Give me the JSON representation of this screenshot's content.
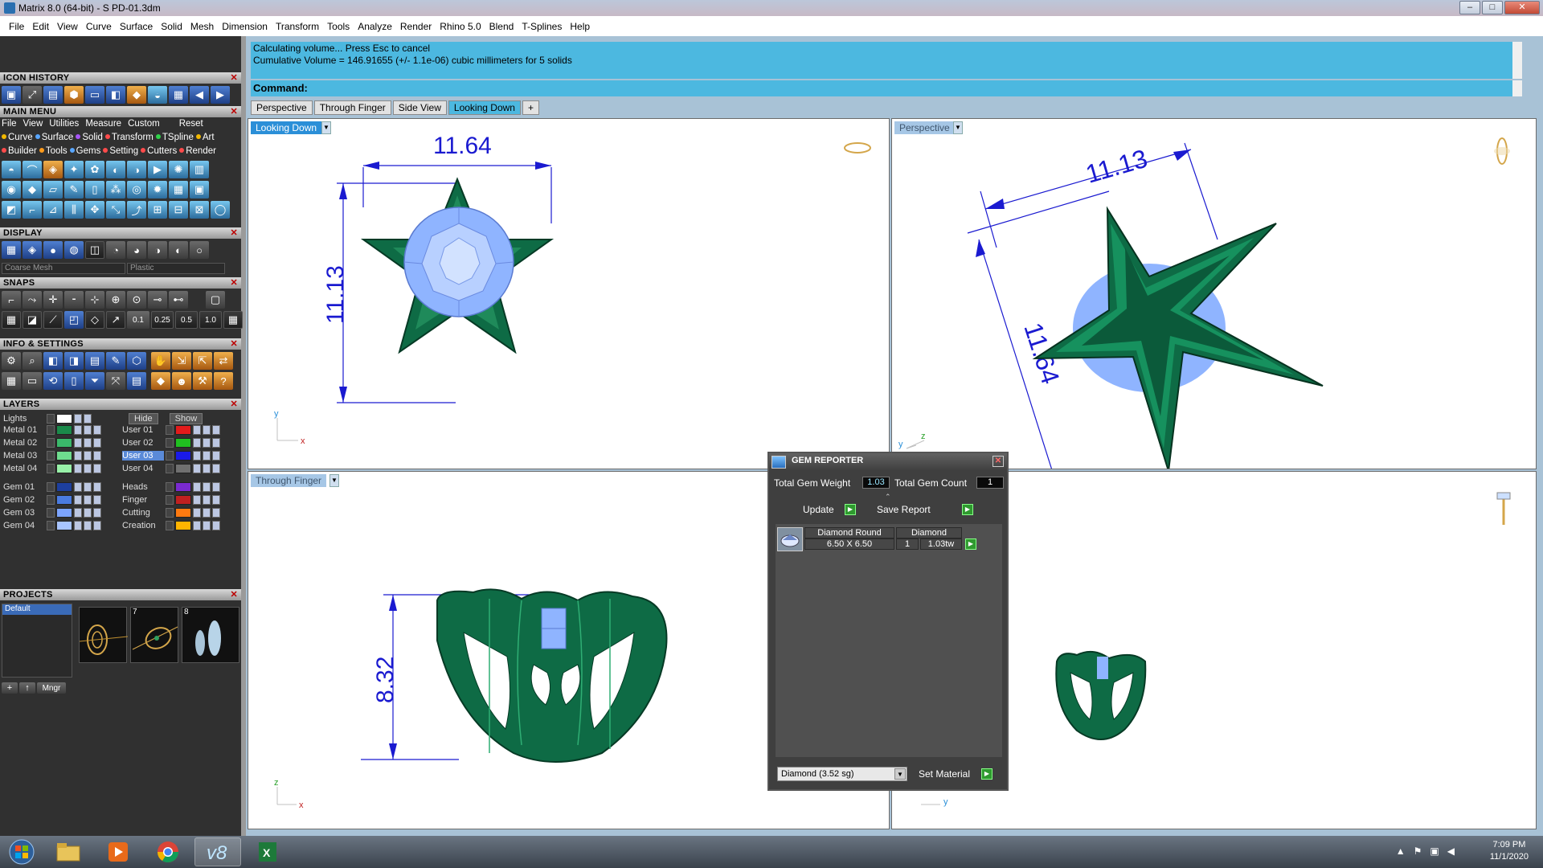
{
  "window": {
    "title": "Matrix 8.0 (64-bit) - S PD-01.3dm",
    "buttons": [
      "–",
      "□",
      "✕"
    ]
  },
  "menubar": [
    "File",
    "Edit",
    "View",
    "Curve",
    "Surface",
    "Solid",
    "Mesh",
    "Dimension",
    "Transform",
    "Tools",
    "Analyze",
    "Render",
    "Rhino 5.0",
    "Blend",
    "T-Splines",
    "Help"
  ],
  "left_panel": {
    "icon_history": "ICON HISTORY",
    "main_menu": "MAIN MENU",
    "main_menu_items": [
      "File",
      "View",
      "Utilities",
      "Measure",
      "Custom",
      "Reset"
    ],
    "menu_row2": [
      "Curve",
      "Surface",
      "Solid",
      "Transform",
      "TSpline",
      "Art"
    ],
    "menu_row3": [
      "Builder",
      "Tools",
      "Gems",
      "Setting",
      "Cutters",
      "Render"
    ],
    "dot_colors": [
      "#f2b800",
      "#58a6ff",
      "#a855f7",
      "#2fd34a",
      "#ff4b4b",
      "#ff9b1c"
    ],
    "display": "DISPLAY",
    "display_mesh": "Coarse Mesh",
    "display_material": "Plastic",
    "snaps": "SNAPS",
    "snap_values": [
      "0.1",
      "0.25",
      "0.5",
      "1.0"
    ],
    "info_settings": "INFO & SETTINGS",
    "layers": "LAYERS",
    "layers_lights": "Lights",
    "hide_label": "Hide",
    "show_label": "Show",
    "layer_left": [
      {
        "name": "Metal 01",
        "color": "#1a8a4a"
      },
      {
        "name": "Metal 02",
        "color": "#3ab86a"
      },
      {
        "name": "Metal 03",
        "color": "#6edc8e"
      },
      {
        "name": "Metal 04",
        "color": "#98f0a8"
      },
      {
        "name": "Gem 01",
        "color": "#1d3f9e"
      },
      {
        "name": "Gem 02",
        "color": "#4a7be0"
      },
      {
        "name": "Gem 03",
        "color": "#7ca4ff"
      },
      {
        "name": "Gem 04",
        "color": "#a8c4ff"
      }
    ],
    "layer_right": [
      {
        "name": "User 01",
        "color": "#e21b1b"
      },
      {
        "name": "User 02",
        "color": "#20c020"
      },
      {
        "name": "User 03",
        "color": "#1a1ae8"
      },
      {
        "name": "User 04",
        "color": "#707070"
      },
      {
        "name": "Heads",
        "color": "#7a2ad0"
      },
      {
        "name": "Finger",
        "color": "#c02020"
      },
      {
        "name": "Cutting",
        "color": "#ff7a10"
      },
      {
        "name": "Creation",
        "color": "#ffb400"
      }
    ],
    "projects": "PROJECTS",
    "project_default": "Default",
    "project_numbers": [
      "7",
      "8"
    ],
    "mngr": "Mngr"
  },
  "command": {
    "line1": "Calculating volume... Press Esc to cancel",
    "line2": "Cumulative Volume = 146.91655 (+/- 1.1e-06) cubic millimeters for 5 solids",
    "prompt": "Command:"
  },
  "tabs": [
    "Perspective",
    "Through Finger",
    "Side View",
    "Looking Down",
    "+"
  ],
  "viewports": {
    "top_left": {
      "label": "Looking Down",
      "dims": {
        "w": "11.64",
        "h": "11.13"
      },
      "axes": [
        "y",
        "x"
      ]
    },
    "top_right": {
      "label": "Perspective",
      "dims": {
        "a": "11.13",
        "b": "11.64"
      },
      "axes": [
        "y",
        "z"
      ]
    },
    "bottom_left": {
      "label": "Through Finger",
      "dims": {
        "h": "8.32"
      },
      "axes": [
        "z",
        "x"
      ]
    },
    "bottom_right": {
      "axes": [
        "y"
      ]
    }
  },
  "gem_reporter": {
    "title": "GEM REPORTER",
    "total_weight_label": "Total Gem Weight",
    "total_weight": "1.03",
    "total_count_label": "Total Gem Count",
    "total_count": "1",
    "update": "Update",
    "save_report": "Save Report",
    "row_shape": "Diamond Round",
    "row_size": "6.50 X 6.50",
    "row_material": "Diamond",
    "row_qty": "1",
    "row_tw": "1.03tw",
    "material_select": "Diamond     (3.52 sg)",
    "set_material": "Set Material"
  },
  "taskbar": {
    "time": "7:09 PM",
    "date": "11/1/2020",
    "apps": [
      "windows-start",
      "file-explorer",
      "media-player",
      "chrome",
      "matrix",
      "excel"
    ]
  },
  "colors": {
    "metal_green": "#0e6b45",
    "gem_blue": "#8fb4ff",
    "dimension_blue": "#1a1ad0",
    "cmd_blue": "#4cb8e0"
  }
}
